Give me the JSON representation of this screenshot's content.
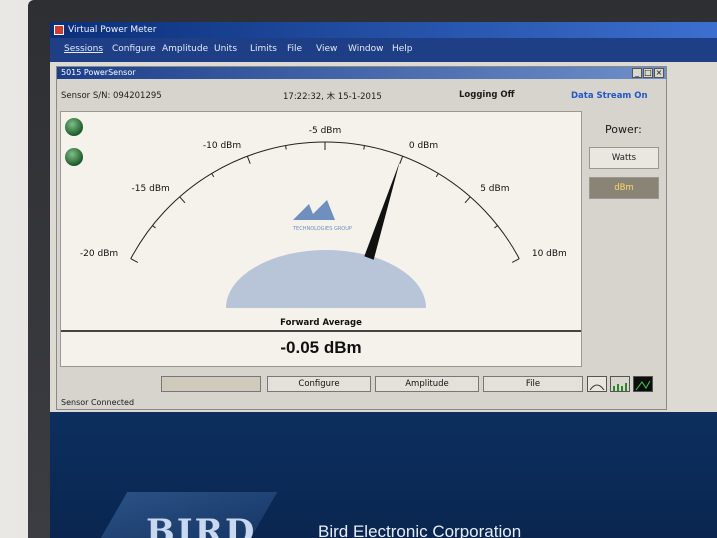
{
  "window": {
    "title": "Virtual Power Meter"
  },
  "menu": [
    "Sessions",
    "Configure",
    "Amplitude",
    "Units",
    "Limits",
    "File",
    "View",
    "Window",
    "Help"
  ],
  "child": {
    "title": "5015 PowerSensor"
  },
  "info": {
    "serial": "Sensor S/N: 094201295",
    "datetime": "17:22:32, 木 15-1-2015",
    "logging": "Logging Off",
    "stream": "Data Stream On"
  },
  "gauge": {
    "ticks": [
      {
        "label": "-20 dBm",
        "value": -20
      },
      {
        "label": "-15 dBm",
        "value": -15
      },
      {
        "label": "-10 dBm",
        "value": -10
      },
      {
        "label": "-5 dBm",
        "value": -5
      },
      {
        "label": "0 dBm",
        "value": 0
      },
      {
        "label": "5 dBm",
        "value": 5
      },
      {
        "label": "10 dBm",
        "value": 10
      }
    ],
    "min": -20,
    "max": 10,
    "reading_dbm": -0.05,
    "needle_color": "#111111",
    "logo_text": "TECHNOLOGIES GROUP"
  },
  "readout": {
    "title": "Forward Average",
    "value": "-0.05 dBm"
  },
  "power": {
    "label": "Power:",
    "watts": "Watts",
    "dbm": "dBm"
  },
  "buttons": {
    "blank": "",
    "configure": "Configure",
    "amplitude": "Amplitude",
    "file": "File"
  },
  "status": {
    "text": "Sensor Connected"
  },
  "desktop": {
    "brand": "BIRD",
    "corp": "Bird Electronic Corporation"
  }
}
